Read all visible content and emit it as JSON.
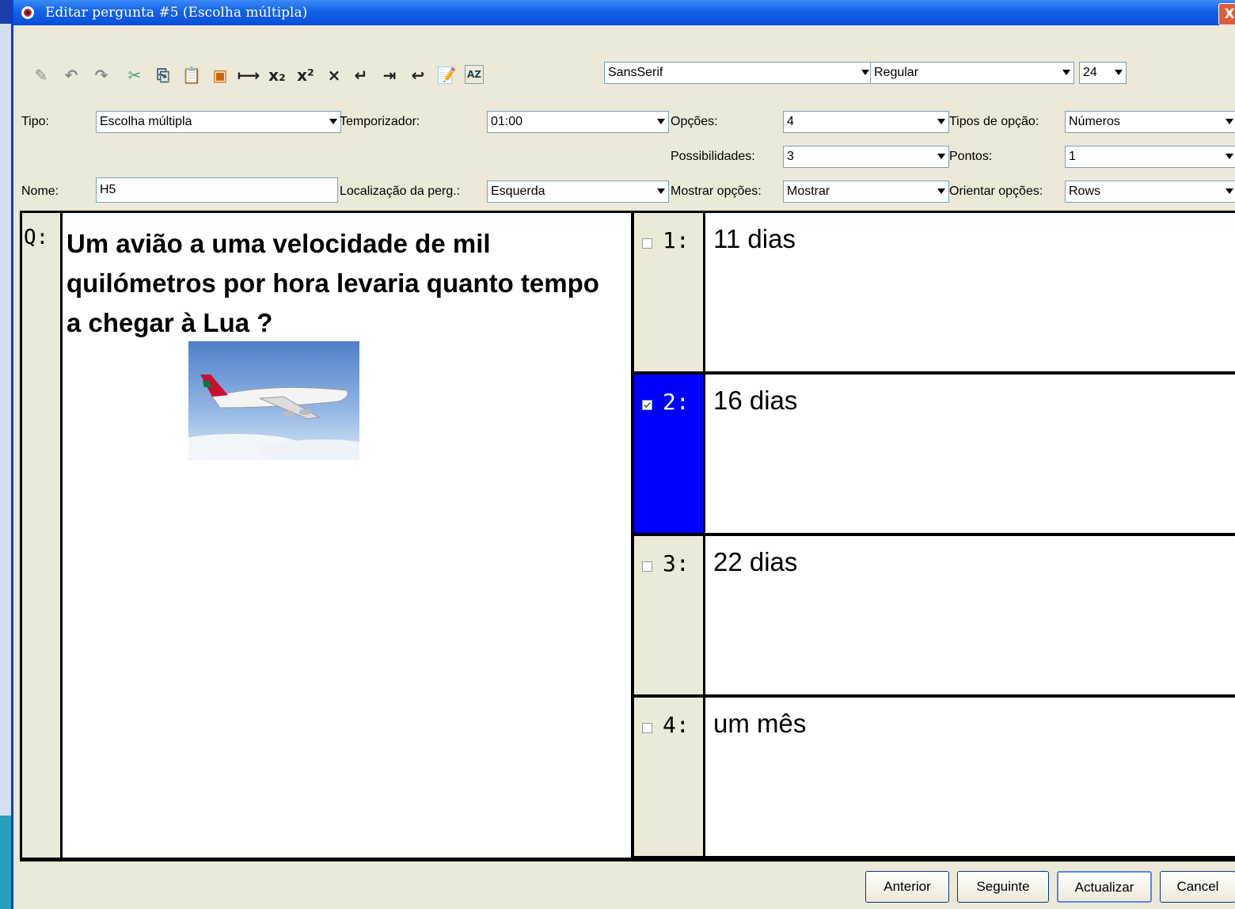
{
  "window": {
    "title": "Editar pergunta #5 (Escolha múltipla)",
    "close_label": "X"
  },
  "toolbar": {
    "font_family": "SansSerif",
    "font_style": "Regular",
    "font_size": "24",
    "icons": [
      "edit-icon",
      "undo-icon",
      "redo-icon",
      "cut-icon",
      "copy-icon",
      "paste-icon",
      "image-icon",
      "line-icon",
      "subscript-icon",
      "superscript-icon",
      "clear-format-icon",
      "insert-row-icon",
      "tab-icon",
      "enter-icon",
      "notes-icon",
      "sort-icon"
    ]
  },
  "settings": {
    "tipo_label": "Tipo:",
    "tipo_value": "Escolha múltipla",
    "temporizador_label": "Temporizador:",
    "temporizador_value": "01:00",
    "opcoes_label": "Opções:",
    "opcoes_value": "4",
    "tipos_opcao_label": "Tipos de opção:",
    "tipos_opcao_value": "Números",
    "possibilidades_label": "Possibilidades:",
    "possibilidades_value": "3",
    "pontos_label": "Pontos:",
    "pontos_value": "1",
    "nome_label": "Nome:",
    "nome_value": "H5",
    "localizacao_label": "Localização da perg.:",
    "localizacao_value": "Esquerda",
    "mostrar_label": "Mostrar opções:",
    "mostrar_value": "Mostrar",
    "orientar_label": "Orientar opções:",
    "orientar_value": "Rows"
  },
  "question": {
    "label": "Q:",
    "text": "Um avião a uma velocidade de mil quilómetros por hora levaria quanto tempo a chegar à Lua ?"
  },
  "options": [
    {
      "number": "1:",
      "text": "11 dias",
      "checked": false
    },
    {
      "number": "2:",
      "text": "16 dias",
      "checked": true
    },
    {
      "number": "3:",
      "text": "22 dias",
      "checked": false
    },
    {
      "number": "4:",
      "text": "um mês",
      "checked": false
    }
  ],
  "buttons": {
    "previous": "Anterior",
    "next": "Seguinte",
    "update": "Actualizar",
    "cancel": "Cancel"
  },
  "colors": {
    "selected_option": "#0000ff",
    "titlebar": "#0a4fd6"
  }
}
